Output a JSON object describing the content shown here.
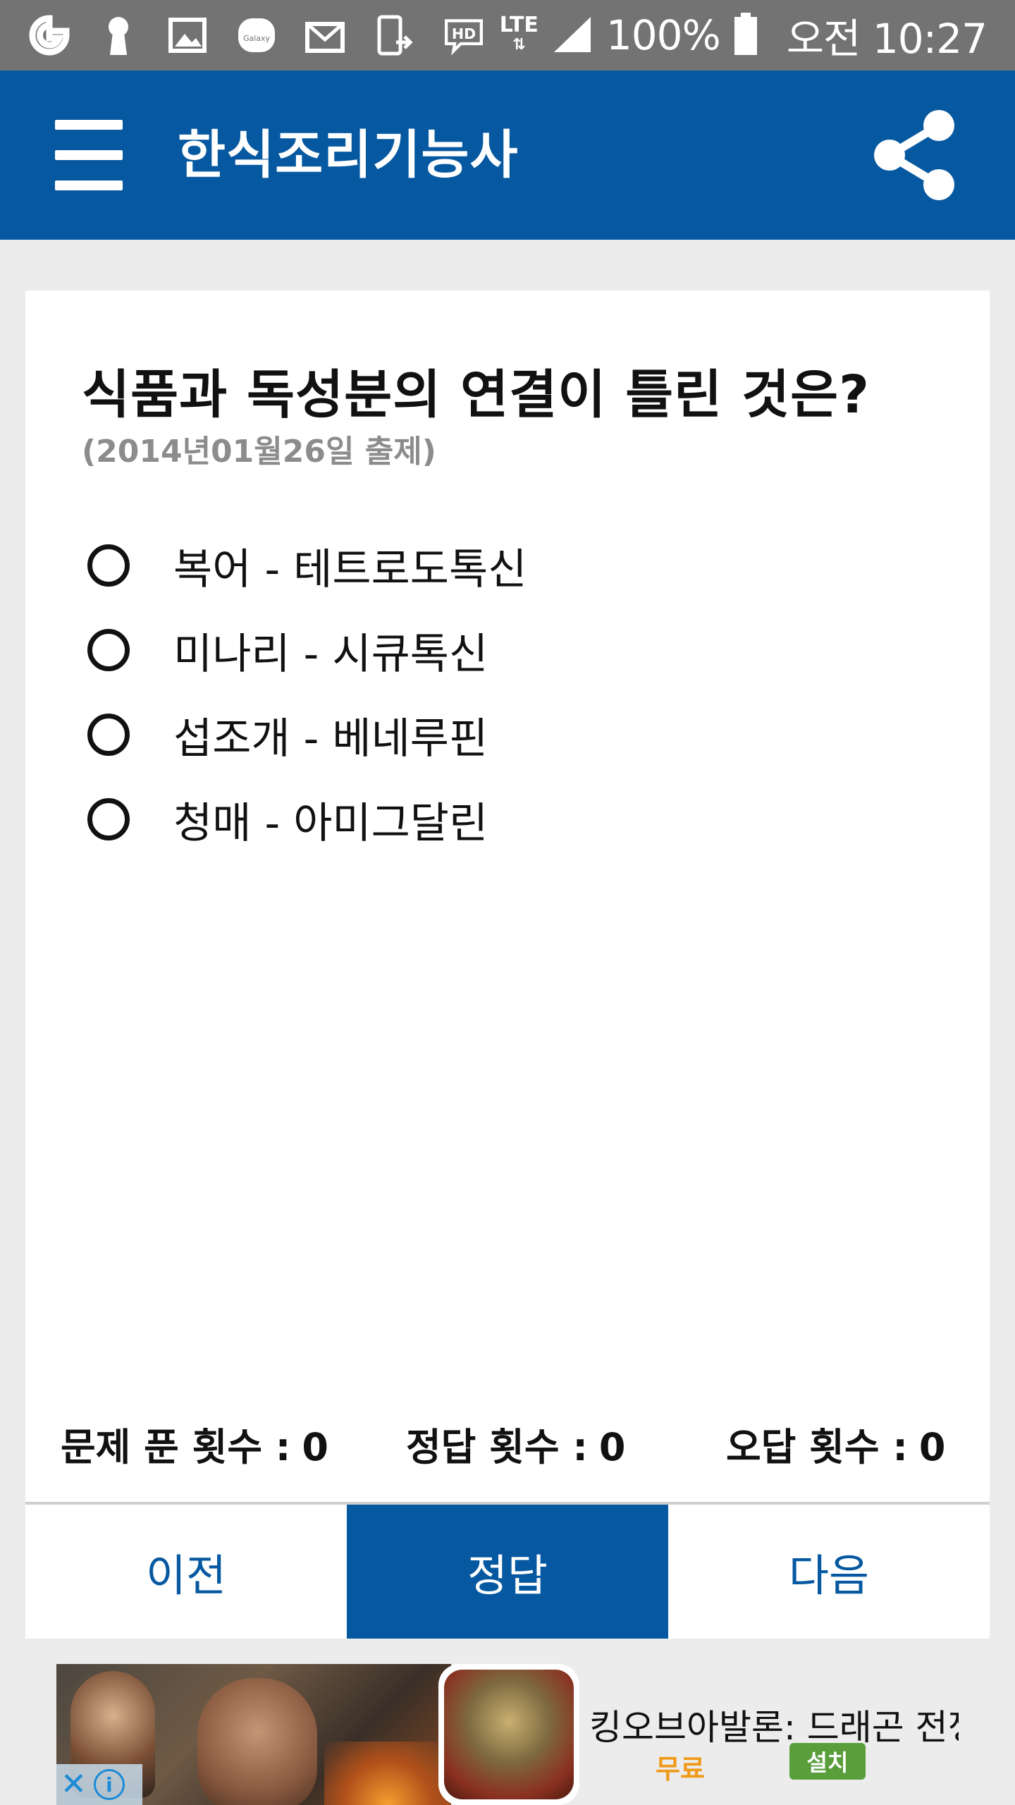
{
  "status_bar": {
    "battery": "100%",
    "time": "오전 10:27",
    "network": "LTE",
    "notification_icons": [
      "g-icon",
      "keyhole-icon",
      "image-icon",
      "galaxy-icon",
      "mail-icon",
      "device-icon",
      "hd-voice-icon"
    ],
    "galaxy_label": "Galaxy",
    "hd_label": "HD"
  },
  "app_bar": {
    "title": "한식조리기능사",
    "menu_icon": "hamburger-menu-icon",
    "share_icon": "share-icon",
    "color": "#0659a1"
  },
  "quiz": {
    "question": "식품과 독성분의 연결이 틀린 것은?",
    "exam_date": "(2014년01월26일 출제)",
    "options": [
      {
        "label": "복어 - 테트로도톡신",
        "selected": false
      },
      {
        "label": "미나리 - 시큐톡신",
        "selected": false
      },
      {
        "label": "섭조개 - 베네루핀",
        "selected": false
      },
      {
        "label": "청매 - 아미그달린",
        "selected": false
      }
    ],
    "stats": {
      "solved_label": "문제 푼 횟수 :",
      "solved_count": "0",
      "correct_label": "정답 횟수 :",
      "correct_count": "0",
      "wrong_label": "오답 횟수 :",
      "wrong_count": "0"
    },
    "buttons": {
      "prev": "이전",
      "answer": "정답",
      "next": "다음"
    }
  },
  "ad": {
    "title": "킹오브아발론: 드래곤 전쟁",
    "price": "무료",
    "install": "설치",
    "close_symbol": "✕",
    "info_symbol": "i"
  }
}
